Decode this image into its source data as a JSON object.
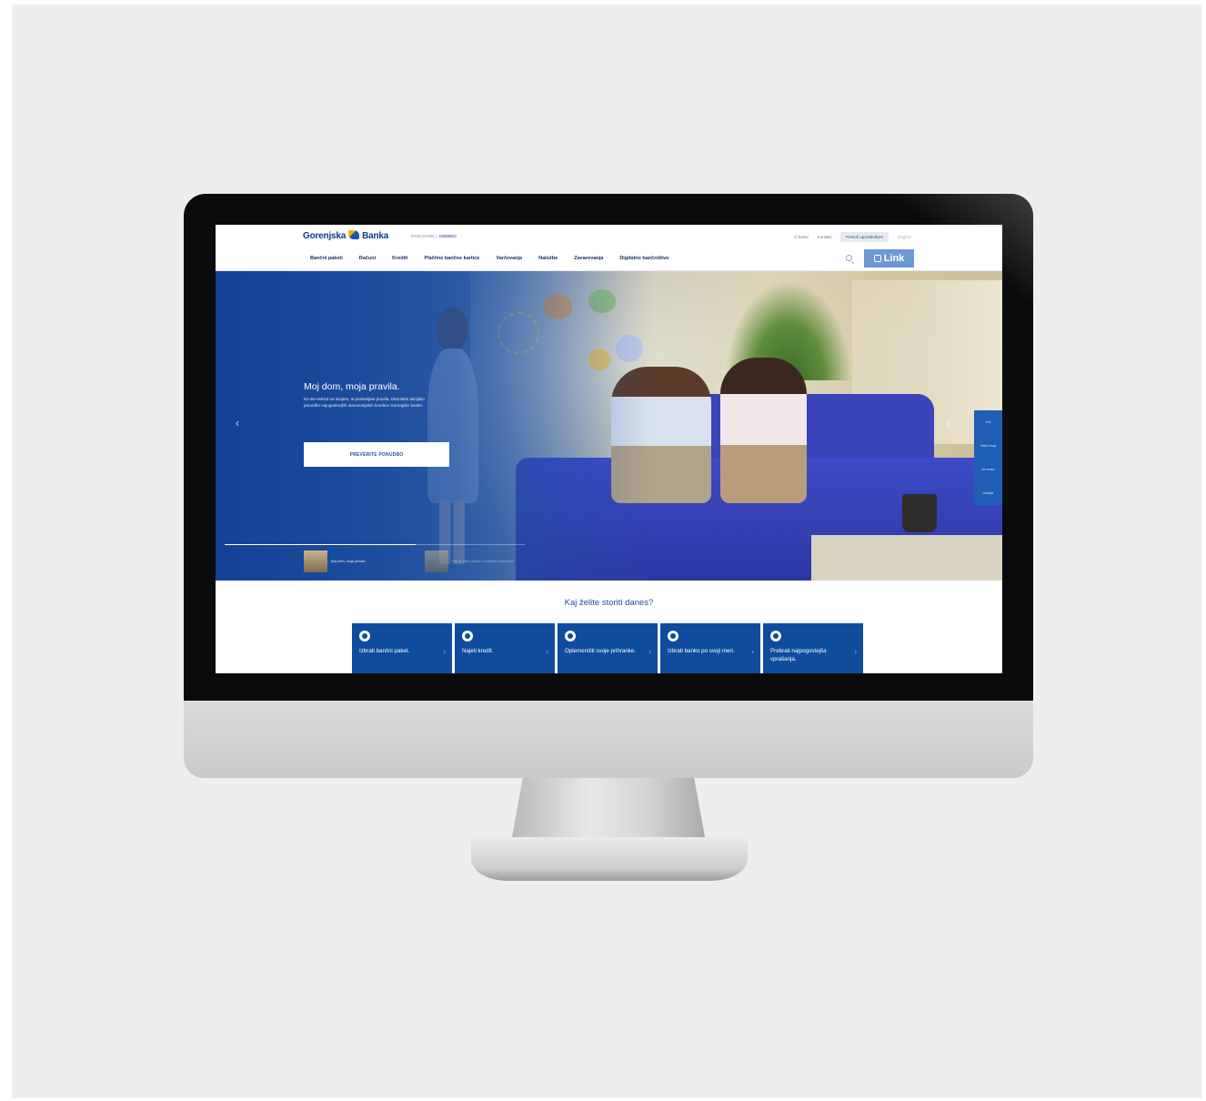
{
  "brand": {
    "logo_text_left": "Gorenjska",
    "logo_text_right": "Banka",
    "primary": "#0f4c9e",
    "accent": "#6c98d6"
  },
  "segments": {
    "private": "POSLOVNO",
    "business": "OSEBNO"
  },
  "toplinks": {
    "about": "O banki",
    "contact": "Kontakt",
    "help": "Pomoč uporabnikom",
    "language": "English"
  },
  "nav": {
    "items": [
      "Bančni paketi",
      "Računi",
      "Krediti",
      "Plačilne bančne kartice",
      "Varčevanja",
      "Naložbe",
      "Zavarovanja",
      "Digitalno bančništvo"
    ]
  },
  "link_button": {
    "label": "Link"
  },
  "hero": {
    "title": "Moj dom, moja pravila.",
    "body": "Ko ste enkrat na svojem, si postavljate pravila. Izkoristite akcijsko ponudbo najugodnejših stanovanjskih kreditov Gorenjske banke.",
    "cta": "PREVERITE PONUDBO",
    "arrow_left": "‹",
    "arrow_right": "›",
    "slides": [
      "Moj dom, moja pravila.",
      "Varna, hitra plačila z mobilnim telefonom"
    ],
    "side_panel": [
      "Link",
      "Stalna vloga",
      "Klic banke",
      "Lokacije"
    ]
  },
  "section": {
    "heading": "Kaj želite storiti danes?"
  },
  "cards": [
    {
      "label": "Izbrati bančni paket.",
      "icon": "package-icon"
    },
    {
      "label": "Najeti kredit.",
      "icon": "loan-icon"
    },
    {
      "label": "Oplemenititi svoje prihranke.",
      "icon": "savings-icon"
    },
    {
      "label": "Izbrati banko po svoji meri.",
      "icon": "bank-icon"
    },
    {
      "label": "Prebrati najpogostejša vprašanja.",
      "icon": "faq-icon"
    }
  ]
}
